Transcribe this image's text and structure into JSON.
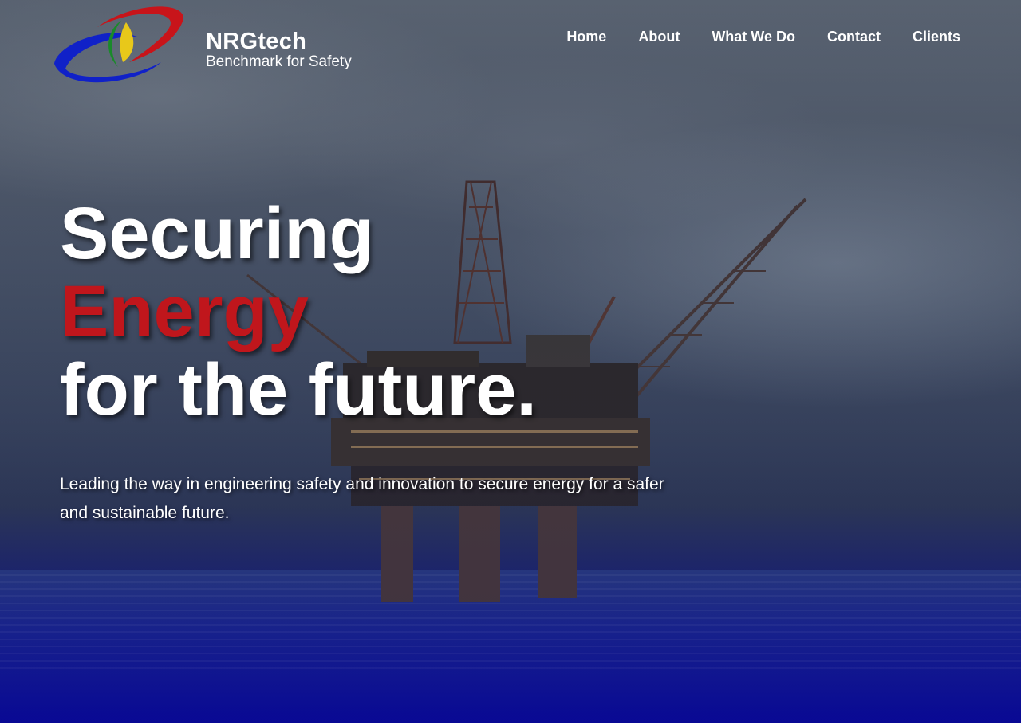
{
  "brand": {
    "name": "NRGtech",
    "tagline": "Benchmark for Safety"
  },
  "nav": {
    "items": [
      {
        "label": "Home"
      },
      {
        "label": "About"
      },
      {
        "label": "What We Do"
      },
      {
        "label": "Contact"
      },
      {
        "label": "Clients"
      }
    ]
  },
  "hero": {
    "line1": "Securing",
    "line2": "Energy",
    "line3": "for the future.",
    "subtext": "Leading the way in engineering safety and innovation to secure energy for a safer and sustainable future."
  },
  "colors": {
    "accent_red": "#c0161c",
    "text": "#ffffff",
    "sea_blue": "#0a0aa0"
  }
}
